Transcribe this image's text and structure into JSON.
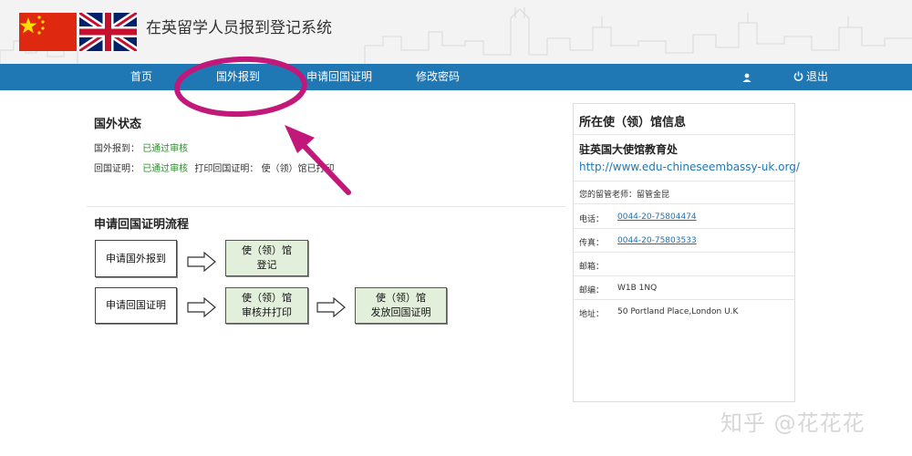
{
  "header": {
    "title": "在英留学人员报到登记系统",
    "flags": [
      "china-flag",
      "uk-flag"
    ]
  },
  "nav": {
    "home": "首页",
    "abroad_report": "国外报到",
    "apply_cert": "申请回国证明",
    "change_password": "修改密码",
    "user_name": "",
    "logout": "退出",
    "bar_color": "#1f78b4"
  },
  "status": {
    "title": "国外状态",
    "abroad_label": "国外报到：",
    "abroad_value": "已通过审核",
    "cert_label": "回国证明：",
    "cert_value": "已通过审核",
    "print_label": "打印回国证明：",
    "print_value": "使（领）馆已打印",
    "ok_color": "#2e8b2e"
  },
  "flow": {
    "title": "申请回国证明流程",
    "step1": "申请国外报到",
    "step2_line1": "使（领）馆",
    "step2_line2": "登记",
    "step3": "申请回国证明",
    "step4_line1": "使（领）馆",
    "step4_line2": "审核并打印",
    "step5_line1": "使（领）馆",
    "step5_line2": "发放回国证明"
  },
  "embassy": {
    "title": "所在使（领）馆信息",
    "org": "驻英国大使馆教育处",
    "url": "http://www.edu-chineseembassy-uk.org/",
    "advisor_label": "您的留管老师：",
    "advisor_value": "留管金昆",
    "phone_label": "电话：",
    "phone_value": "0044-20-75804474",
    "fax_label": "传真：",
    "fax_value": "0044-20-75803533",
    "email_label": "邮箱：",
    "email_value": "",
    "postcode_label": "邮编：",
    "postcode_value": "W1B 1NQ",
    "address_label": "地址：",
    "address_value": "50 Portland Place,London U.K"
  },
  "annotation": {
    "color": "#c2187a"
  },
  "watermark": "知乎 @花花花"
}
